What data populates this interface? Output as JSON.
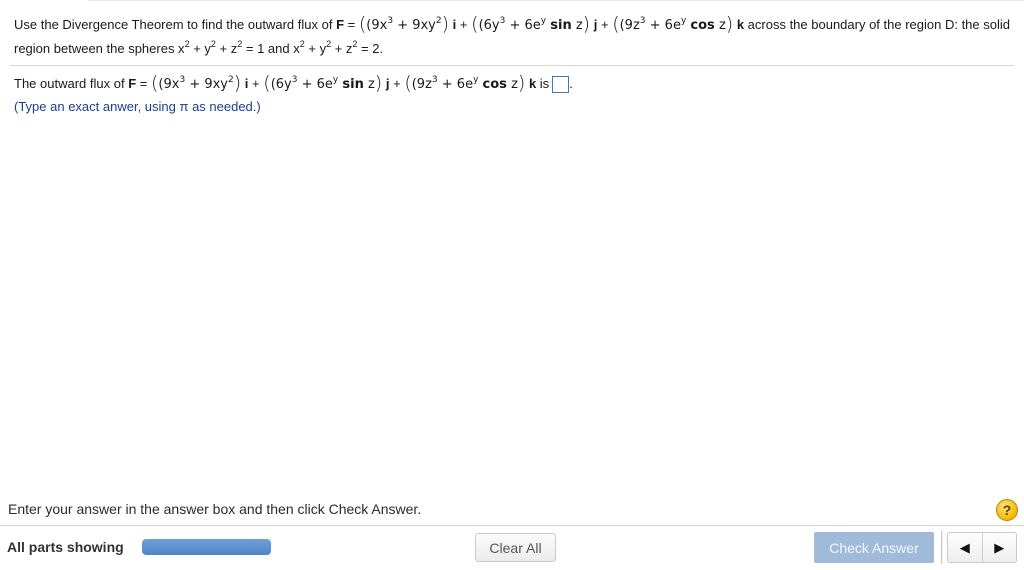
{
  "problem": {
    "intro": "Use the Divergence Theorem to find the outward flux of",
    "field_label": "F",
    "eq": "=",
    "i_open": "(9x",
    "i_exp1": "3",
    "i_mid": " + 9xy",
    "i_exp2": "2",
    "i_close": ")",
    "i_unit": "i",
    "plus": "+",
    "j_open": "(6y",
    "j_exp1": "3",
    "j_mid": " + 6e",
    "j_exp2": "y",
    "j_fn": "sin",
    "j_arg": "z",
    "j_close": ")",
    "j_unit": "j",
    "k_open": "(9z",
    "k_exp1": "3",
    "k_mid": " + 6e",
    "k_exp2": "y",
    "k_fn": "cos",
    "k_arg": "z",
    "k_close": ")",
    "k_unit": "k",
    "tail": "across the boundary of the region D: the solid",
    "line2_start": "region between the spheres x",
    "sq": "2",
    "sphere_plus": " + y",
    "sphere_plus_z": " + z",
    "eq1": " = 1 and x",
    "eq2": " = 2."
  },
  "answer": {
    "prefix": "The outward flux of",
    "is_label": "is",
    "period": ".",
    "hint": "(Type an exact anwer, using π as needed.)"
  },
  "footer": {
    "instruction": "Enter your answer in the answer box and then click Check Answer.",
    "help_label": "?",
    "parts_label": "All parts showing",
    "progress": 1.0,
    "clear_label": "Clear All",
    "check_label": "Check Answer",
    "prev_icon": "◀",
    "next_icon": "▶"
  }
}
